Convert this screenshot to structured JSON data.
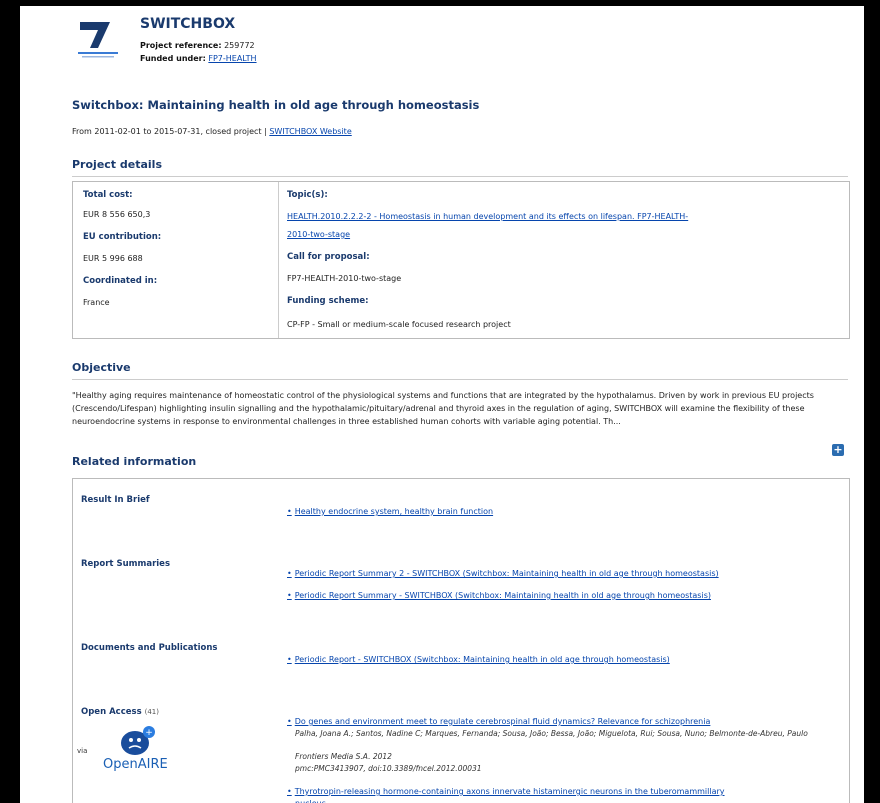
{
  "project": {
    "name": "SWITCHBOX",
    "reference_label": "Project reference:",
    "reference": "259772",
    "funded_label": "Funded under:",
    "funded": "FP7-HEALTH"
  },
  "title": "Switchbox: Maintaining health in old age through homeostasis",
  "dates": {
    "text": "From 2011-02-01 to 2015-07-31, closed project | ",
    "website": "SWITCHBOX Website"
  },
  "details": {
    "heading": "Project details",
    "total_cost_label": "Total cost:",
    "total_cost": "EUR 8 556 650,3",
    "eu_contribution_label": "EU contribution:",
    "eu_contribution": "EUR 5 996 688",
    "coordinated_label": "Coordinated in:",
    "coordinated": "France",
    "topics_label": "Topic(s):",
    "topic_line1": "HEALTH.2010.2.2.2-2 - Homeostasis in human development and its effects on lifespan. FP7-HEALTH-",
    "topic_line2": "2010-two-stage",
    "call_label": "Call for proposal:",
    "call": "FP7-HEALTH-2010-two-stage",
    "scheme_label": "Funding scheme:",
    "scheme": "CP-FP - Small or medium-scale focused research project"
  },
  "objective": {
    "heading": "Objective",
    "text": "\"Healthy aging requires maintenance of homeostatic control of the physiological systems and functions that are integrated by the hypothalamus. Driven by work in previous EU projects (Crescendo/Lifespan) highlighting insulin signalling and the hypothalamic/pituitary/adrenal and thyroid axes in the regulation of aging, SWITCHBOX will examine the flexibility of these neuroendocrine systems in response to environmental challenges in three established human cohorts with variable aging potential. Th..."
  },
  "related": {
    "heading": "Related information",
    "result_label": "Result In Brief",
    "result_link": "Healthy endocrine system, healthy brain function",
    "reports_label": "Report Summaries",
    "report1": "Periodic Report Summary 2 - SWITCHBOX (Switchbox: Maintaining health in old age through homeostasis)",
    "report2": "Periodic Report Summary - SWITCHBOX (Switchbox: Maintaining health in old age through homeostasis)",
    "docs_label": "Documents and Publications",
    "doc1": "Periodic Report - SWITCHBOX (Switchbox: Maintaining health in old age through homeostasis)",
    "oa_label": "Open Access",
    "oa_count": "(41)",
    "via": "via",
    "openaire": "OpenAIRE",
    "pub1_title": "Do genes and environment meet to regulate cerebrospinal fluid dynamics? Relevance for schizophrenia",
    "pub1_authors": "Palha, Joana A.; Santos, Nadine C; Marques, Fernanda; Sousa, João; Bessa, João; Miguelota, Rui; Sousa, Nuno; Belmonte-de-Abreu, Paulo",
    "pub1_source": "Frontiers Media S.A. 2012",
    "pub1_ids": "pmc:PMC3413907, doi:10.3389/fncel.2012.00031",
    "pub2_title_l1": "Thyrotropin-releasing hormone-containing axons innervate histaminergic neurons in the tuberomammillary",
    "pub2_title_l2": "nucleus"
  },
  "colors": {
    "heading": "#1a3a6d",
    "link": "#0645ad",
    "accent": "#2b6cb0"
  }
}
